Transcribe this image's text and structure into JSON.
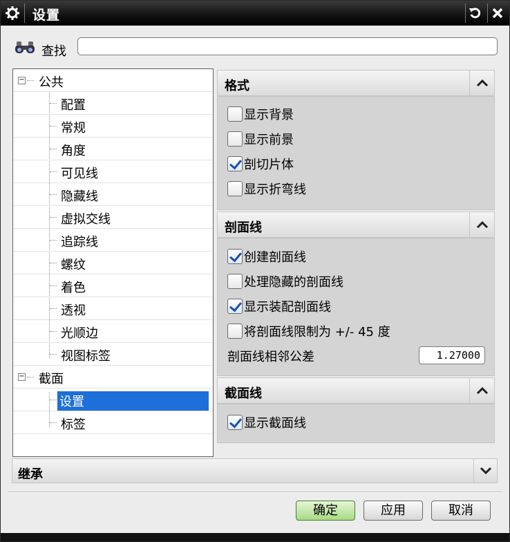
{
  "window": {
    "title": "设置"
  },
  "find": {
    "label": "查找",
    "value": ""
  },
  "tree": {
    "items": [
      {
        "label": "公共",
        "expander": "⊟"
      },
      {
        "label": "配置"
      },
      {
        "label": "常规"
      },
      {
        "label": "角度"
      },
      {
        "label": "可见线"
      },
      {
        "label": "隐藏线"
      },
      {
        "label": "虚拟交线"
      },
      {
        "label": "追踪线"
      },
      {
        "label": "螺纹"
      },
      {
        "label": "着色"
      },
      {
        "label": "透视"
      },
      {
        "label": "光顺边"
      },
      {
        "label": "视图标签"
      },
      {
        "label": "截面",
        "expander": "⊟"
      },
      {
        "label": "设置",
        "selected": true
      },
      {
        "label": "标签"
      }
    ]
  },
  "sections": {
    "format": {
      "title": "格式",
      "items": [
        {
          "label": "显示背景",
          "checked": false
        },
        {
          "label": "显示前景",
          "checked": false
        },
        {
          "label": "剖切片体",
          "checked": true
        },
        {
          "label": "显示折弯线",
          "checked": false
        }
      ]
    },
    "hatch": {
      "title": "剖面线",
      "items": [
        {
          "label": "创建剖面线",
          "checked": true
        },
        {
          "label": "处理隐藏的剖面线",
          "checked": false
        },
        {
          "label": "显示装配剖面线",
          "checked": true
        },
        {
          "label": "将剖面线限制为 +/- 45 度",
          "checked": false
        }
      ],
      "tolerance_label": "剖面线相邻公差",
      "tolerance_value": "1.27000"
    },
    "section_line": {
      "title": "截面线",
      "items": [
        {
          "label": "显示截面线",
          "checked": true
        }
      ]
    },
    "inherit": {
      "title": "继承"
    }
  },
  "buttons": {
    "ok": "确定",
    "apply": "应用",
    "cancel": "取消"
  },
  "colors": {
    "selection": "#1e6fd9",
    "ok_button": "#a7da84",
    "titlebar": "#111111"
  }
}
